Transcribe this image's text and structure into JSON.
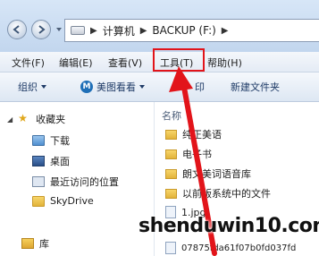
{
  "address_bar": {
    "crumbs": [
      "计算机",
      "BACKUP (F:)"
    ]
  },
  "menubar": {
    "items": [
      "文件(F)",
      "编辑(E)",
      "查看(V)",
      "工具(T)",
      "帮助(H)"
    ]
  },
  "toolbar": {
    "organize": "组织",
    "meitu": "美图看看",
    "print_partial": "印",
    "new_folder": "新建文件夹"
  },
  "sidebar": {
    "favorites": "收藏夹",
    "items": [
      "下载",
      "桌面",
      "最近访问的位置",
      "SkyDrive"
    ],
    "library": "库"
  },
  "content": {
    "column_header": "名称",
    "files": [
      "纯正美语",
      "电子书",
      "朗文美词语音库",
      "以前版系统中的文件",
      "1.jpg",
      "07875fda61f07b0fd037fd"
    ]
  },
  "watermark": "shenduwin10.com",
  "colors": {
    "highlight_red": "#e2141a",
    "arrow_red": "#e2141a"
  },
  "icons": [
    "back-arrow",
    "forward-arrow",
    "drive",
    "star",
    "folder",
    "desktop",
    "recent",
    "library",
    "image-file"
  ]
}
